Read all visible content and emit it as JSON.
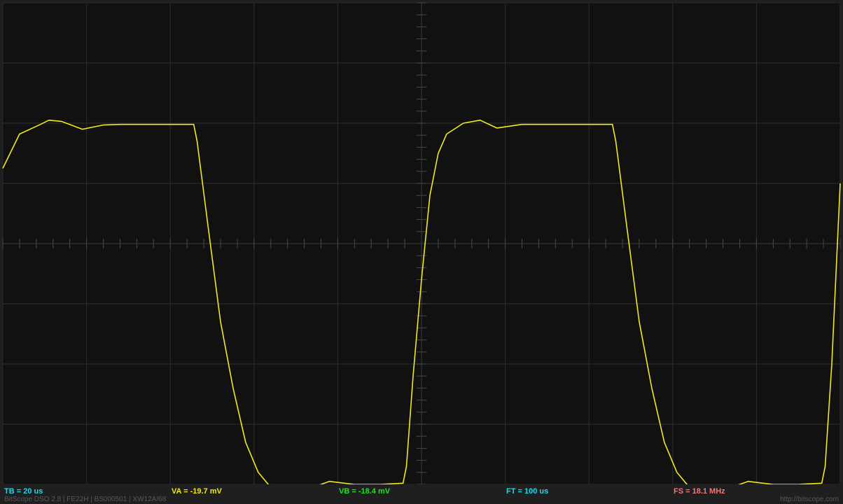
{
  "colors": {
    "background": "#1f1f1f",
    "screen": "#111111",
    "grid": "#2e2e2e",
    "trace": "#f0ea1e",
    "tb": "#22d8e8",
    "va": "#f0ea1e",
    "vb": "#22e02a",
    "ft": "#22d8e8",
    "fs": "#f07878",
    "footer": "#585858"
  },
  "readouts": {
    "tb": "TB = 20 us",
    "va": "VA = -19.7 mV",
    "vb": "VB = -18.4 mV",
    "ft": "FT = 100 us",
    "fs": "FS = 18.1 MHz"
  },
  "footer": {
    "device_info": "BitScope DSO 2.8 | FE22H | BS000501 | XW12A/68",
    "url": "http://bitscope.com"
  },
  "chart_data": {
    "type": "line",
    "title": "",
    "xlabel": "",
    "ylabel": "",
    "x_divisions": 10,
    "y_divisions": 8,
    "xlim": [
      0,
      10
    ],
    "ylim": [
      -4,
      4
    ],
    "grid": true,
    "series": [
      {
        "color": "#f0ea1e",
        "x": [
          0,
          0.2,
          0.45,
          0.55,
          0.7,
          0.95,
          1.2,
          1.4,
          2.0,
          2.28,
          2.32,
          2.45,
          2.6,
          2.75,
          2.9,
          3.05,
          3.2,
          3.5,
          3.7,
          3.9,
          4.2,
          4.5,
          4.78,
          4.82,
          4.9,
          5.0,
          5.1,
          5.2,
          5.3,
          5.5,
          5.7,
          5.9,
          6.2,
          6.5,
          7.0,
          7.28,
          7.32,
          7.45,
          7.6,
          7.75,
          7.9,
          8.05,
          8.2,
          8.5,
          8.7,
          8.9,
          9.2,
          9.5,
          9.78,
          9.82,
          9.9,
          10.0
        ],
        "y": [
          1.25,
          1.82,
          1.98,
          2.05,
          2.03,
          1.9,
          1.97,
          1.98,
          1.98,
          1.98,
          1.7,
          0.3,
          -1.3,
          -2.4,
          -3.3,
          -3.8,
          -4.05,
          -4.15,
          -4.05,
          -3.95,
          -4.0,
          -4.0,
          -3.98,
          -3.7,
          -2.2,
          -0.6,
          0.8,
          1.5,
          1.82,
          2.0,
          2.05,
          1.92,
          1.98,
          1.98,
          1.98,
          1.98,
          1.7,
          0.3,
          -1.3,
          -2.4,
          -3.3,
          -3.8,
          -4.05,
          -4.15,
          -4.05,
          -3.95,
          -4.0,
          -4.0,
          -3.98,
          -3.7,
          -2.0,
          1.0
        ]
      }
    ]
  }
}
